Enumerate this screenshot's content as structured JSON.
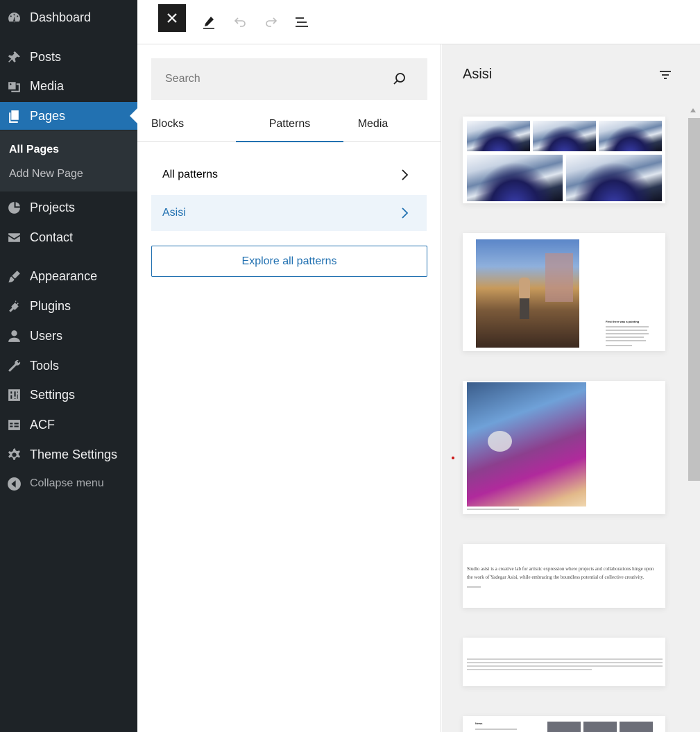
{
  "sidebar": {
    "items": [
      {
        "label": "Dashboard",
        "icon": "dashboard-icon"
      },
      {
        "label": "Posts",
        "icon": "pin-icon"
      },
      {
        "label": "Media",
        "icon": "media-icon"
      },
      {
        "label": "Pages",
        "icon": "pages-icon"
      },
      {
        "label": "Projects",
        "icon": "projects-icon"
      },
      {
        "label": "Contact",
        "icon": "envelope-icon"
      },
      {
        "label": "Appearance",
        "icon": "brush-icon"
      },
      {
        "label": "Plugins",
        "icon": "plug-icon"
      },
      {
        "label": "Users",
        "icon": "user-icon"
      },
      {
        "label": "Tools",
        "icon": "wrench-icon"
      },
      {
        "label": "Settings",
        "icon": "sliders-icon"
      },
      {
        "label": "ACF",
        "icon": "table-icon"
      },
      {
        "label": "Theme Settings",
        "icon": "gear-icon"
      }
    ],
    "submenu": {
      "all_pages": "All Pages",
      "add_new": "Add New Page"
    },
    "collapse_label": "Collapse menu",
    "accent_color": "#2271b1"
  },
  "toolbar": {
    "close": "close-icon",
    "tools": "pencil-icon",
    "undo": "undo-icon",
    "redo": "redo-icon",
    "outline": "list-view-icon"
  },
  "inserter": {
    "search_placeholder": "Search",
    "tabs": [
      "Blocks",
      "Patterns",
      "Media"
    ],
    "active_tab": "Patterns",
    "categories": [
      "All patterns",
      "Asisi"
    ],
    "selected_category": "Asisi",
    "explore_label": "Explore all patterns"
  },
  "pattern_panel": {
    "title": "Asisi",
    "cards": {
      "painting_heading": "First there was a painting",
      "studio_text": "Studio asisi is a creative lab for artistic expression where projects and collaborations hinge upon the work of Yadegar Asisi, while embracing the boundless potential of collective creativity.",
      "news_heading": "News"
    }
  }
}
